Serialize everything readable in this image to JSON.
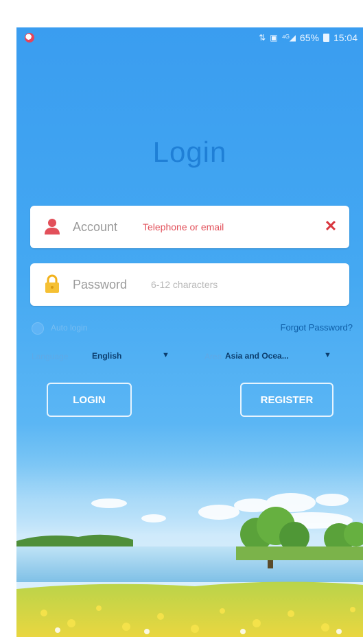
{
  "status_bar": {
    "battery": "65%",
    "time": "15:04"
  },
  "title": "Login",
  "account": {
    "label": "Account",
    "placeholder": "Telephone or email"
  },
  "password": {
    "label": "Password",
    "placeholder": "6-12 characters"
  },
  "auto_login": {
    "label": "Auto login"
  },
  "forgot_password": "Forgot Password?",
  "language": {
    "label": "Language",
    "value": "English"
  },
  "area": {
    "label": "Area",
    "value": "Asia and Ocea..."
  },
  "buttons": {
    "login": "LOGIN",
    "register": "REGISTER"
  },
  "colors": {
    "background": "#44a8f2",
    "accent_red": "#d9363e",
    "title": "#1f7fd6"
  }
}
